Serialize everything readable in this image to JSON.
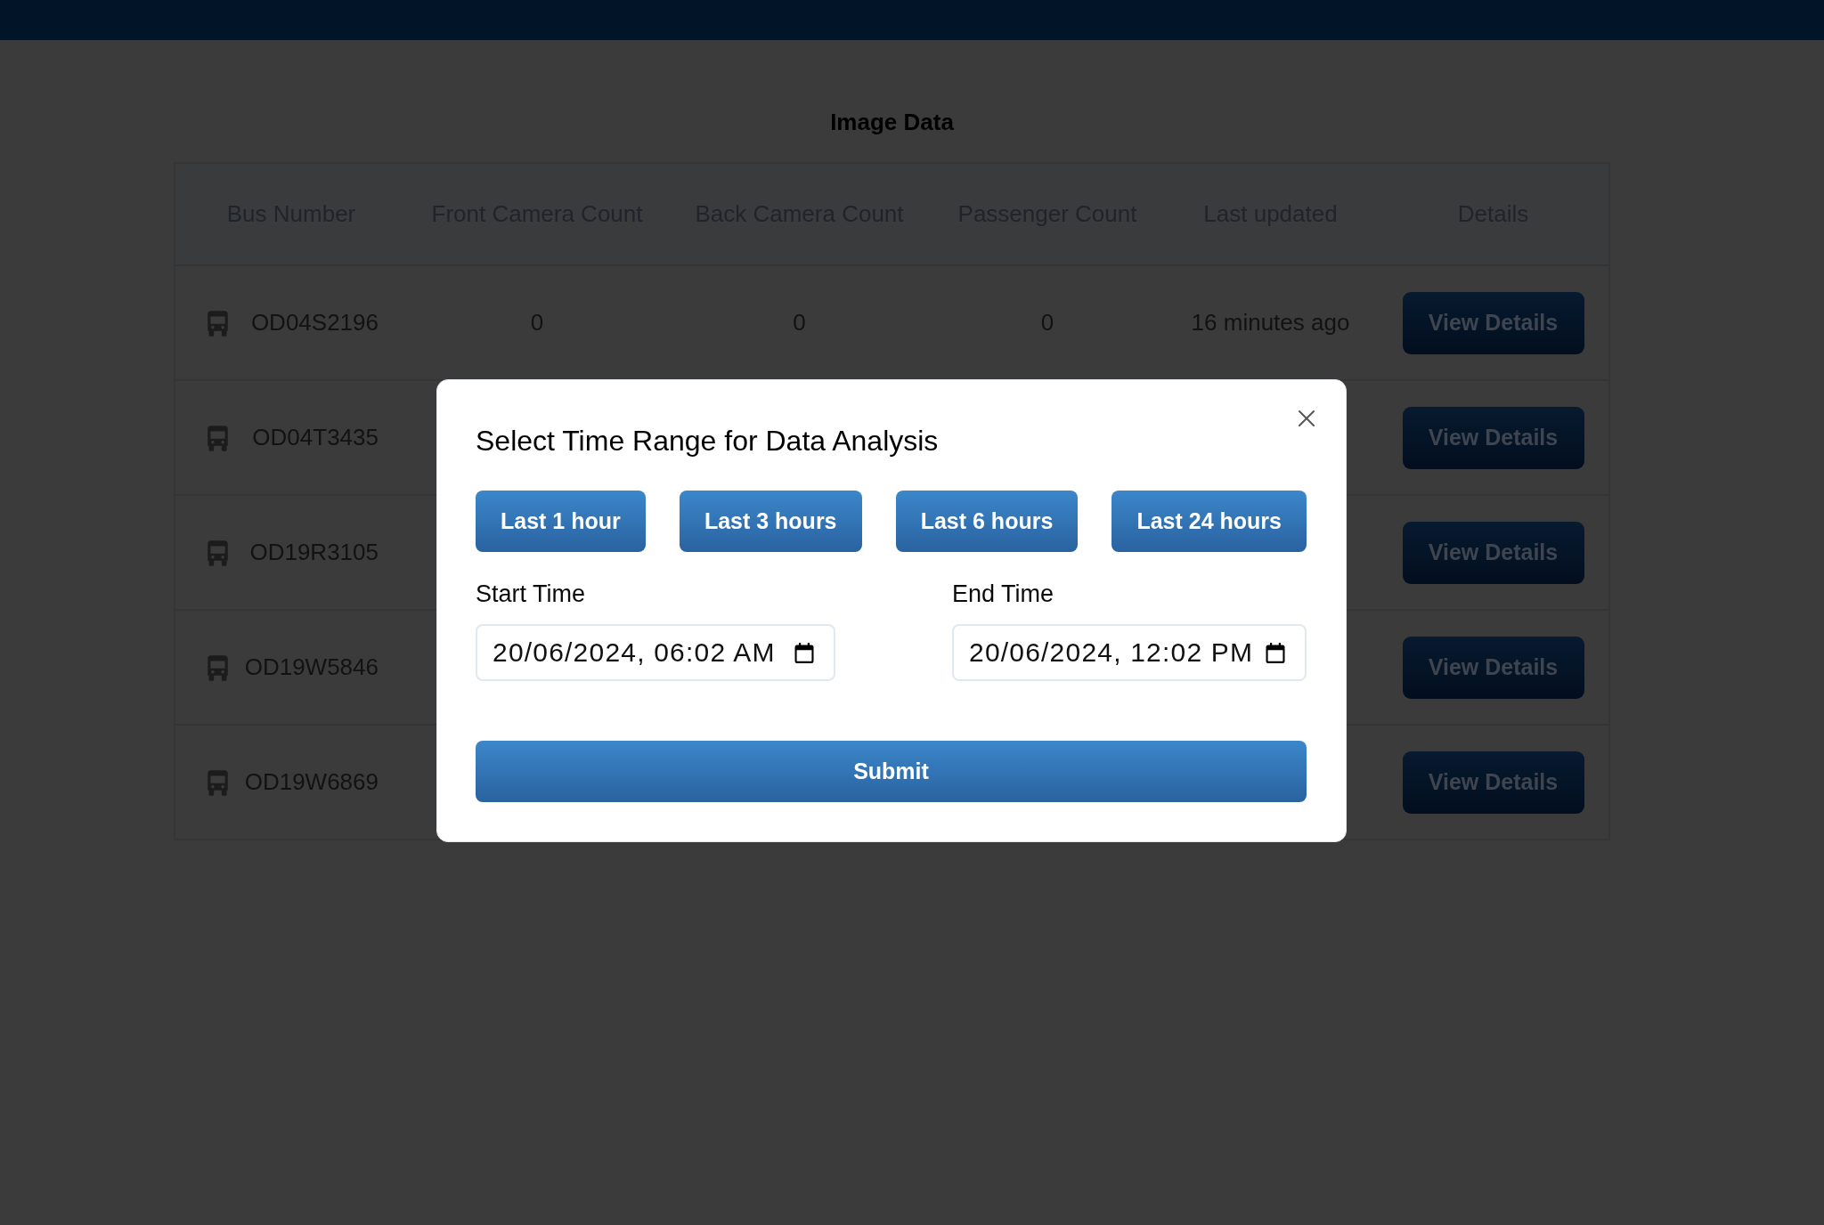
{
  "page": {
    "title": "Image Data"
  },
  "table": {
    "columns": [
      "Bus Number",
      "Front Camera Count",
      "Back Camera Count",
      "Passenger Count",
      "Last updated",
      "Details"
    ],
    "rows": [
      {
        "bus_number": "OD04S2196",
        "front_camera_count": "0",
        "back_camera_count": "0",
        "passenger_count": "0",
        "last_updated": "16 minutes ago",
        "details_button": "View Details"
      },
      {
        "bus_number": "OD04T3435",
        "details_button": "View Details"
      },
      {
        "bus_number": "OD19R3105",
        "details_button": "View Details"
      },
      {
        "bus_number": "OD19W5846",
        "details_button": "View Details"
      },
      {
        "bus_number": "OD19W6869",
        "details_button": "View Details"
      }
    ]
  },
  "modal": {
    "title": "Select Time Range for Data Analysis",
    "quick_ranges": [
      "Last 1 hour",
      "Last 3 hours",
      "Last 6 hours",
      "Last 24 hours"
    ],
    "fields": [
      {
        "label": "Start Time",
        "value": "20/06/2024, 06:02 AM"
      },
      {
        "label": "End Time",
        "value": "20/06/2024, 12:02 PM"
      }
    ],
    "submit": "Submit"
  }
}
